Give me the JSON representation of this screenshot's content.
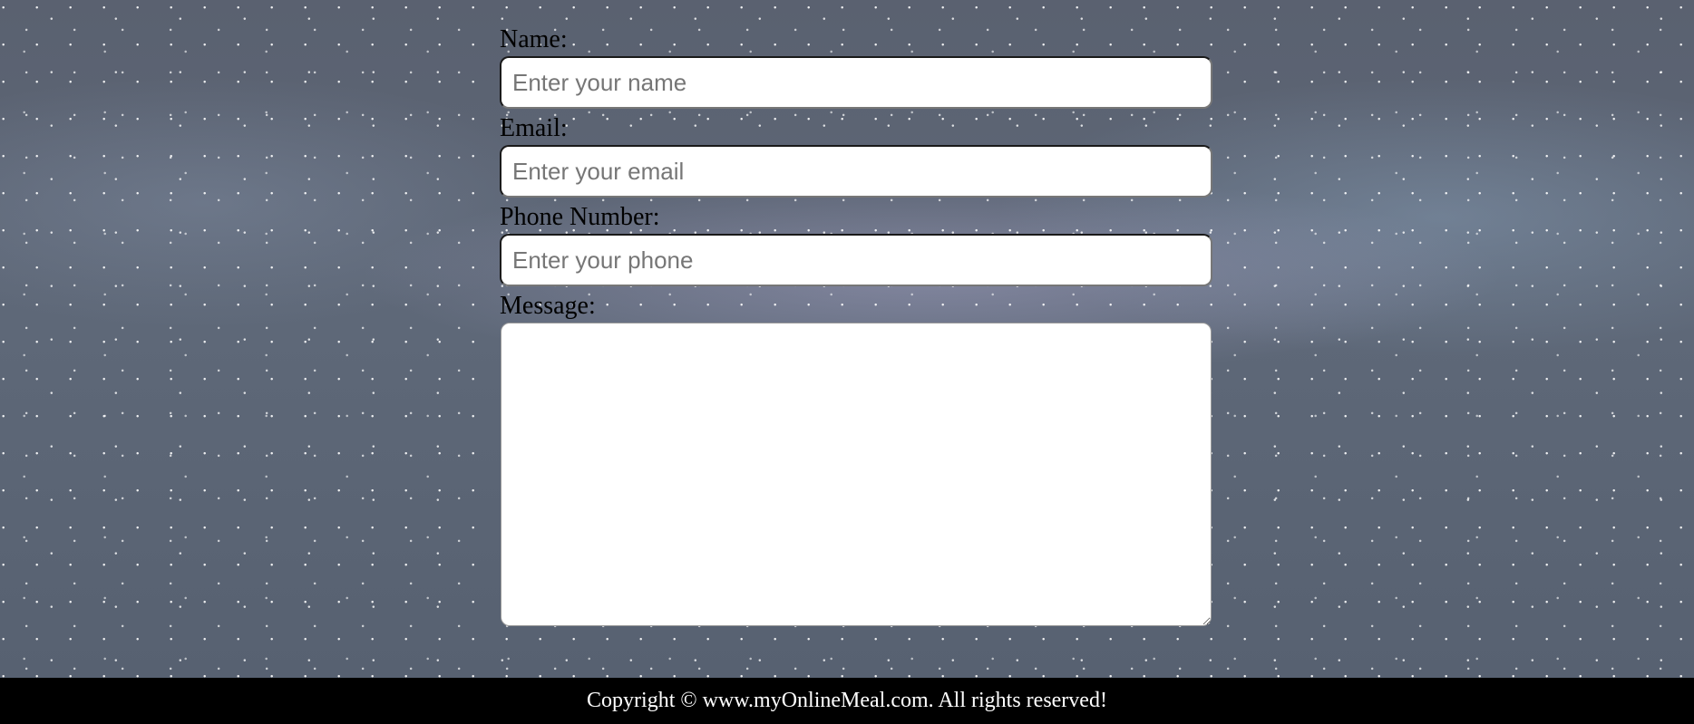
{
  "form": {
    "name": {
      "label": "Name:",
      "value": "",
      "placeholder": "Enter your name"
    },
    "email": {
      "label": "Email:",
      "value": "",
      "placeholder": "Enter your email"
    },
    "phone": {
      "label": "Phone Number:",
      "value": "",
      "placeholder": "Enter your phone"
    },
    "message": {
      "label": "Message:",
      "value": ""
    }
  },
  "footer": {
    "copyright": "Copyright © www.myOnlineMeal.com. All rights reserved!"
  },
  "colors": {
    "footer_background": "#000000",
    "footer_text": "#ffffff",
    "input_background": "#ffffff"
  }
}
